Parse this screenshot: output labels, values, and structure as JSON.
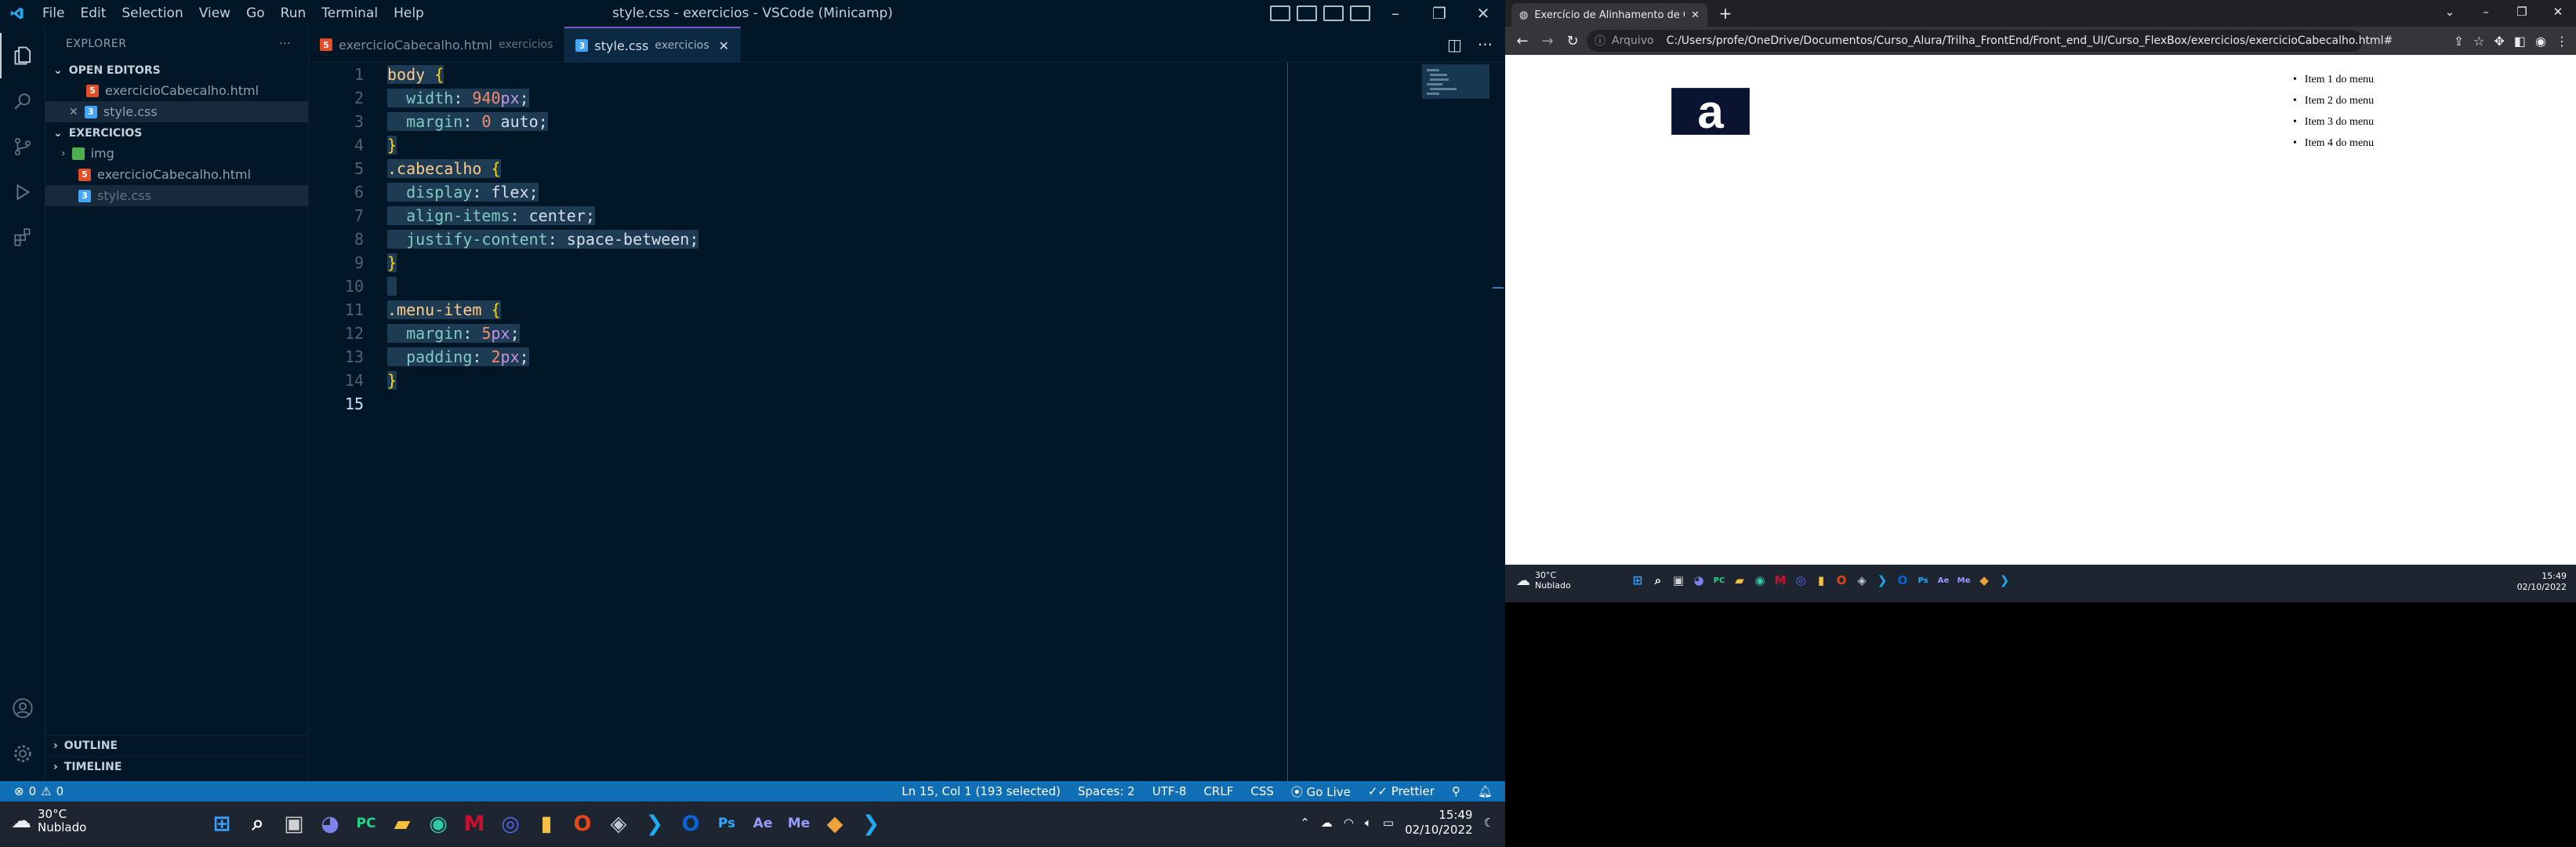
{
  "vscode": {
    "menu": [
      "File",
      "Edit",
      "Selection",
      "View",
      "Go",
      "Run",
      "Terminal",
      "Help"
    ],
    "window_title": "style.css - exercicios - VSCode (Minicamp)",
    "explorer": {
      "header": "EXPLORER",
      "open_editors_label": "OPEN EDITORS",
      "open_editors": [
        {
          "name": "exercicioCabecalho.html",
          "type": "html"
        },
        {
          "name": "style.css",
          "type": "css"
        }
      ],
      "folder_label": "EXERCICIOS",
      "folder_items": [
        {
          "name": "img",
          "type": "folder"
        },
        {
          "name": "exercicioCabecalho.html",
          "type": "html"
        },
        {
          "name": "style.css",
          "type": "css"
        }
      ],
      "outline_label": "OUTLINE",
      "timeline_label": "TIMELINE"
    },
    "tabs": [
      {
        "name": "exercicioCabecalho.html",
        "folder": "exercicios",
        "type": "html"
      },
      {
        "name": "style.css",
        "folder": "exercicios",
        "type": "css"
      }
    ],
    "line_numbers": [
      "1",
      "2",
      "3",
      "4",
      "5",
      "6",
      "7",
      "8",
      "9",
      "10",
      "11",
      "12",
      "13",
      "14",
      "15"
    ],
    "status": {
      "errors": "0",
      "warnings": "0",
      "position": "Ln 15, Col 1 (193 selected)",
      "spaces": "Spaces: 2",
      "encoding": "UTF-8",
      "eol": "CRLF",
      "language": "CSS",
      "golive": "Go Live",
      "prettier": "Prettier"
    },
    "taskbar": {
      "temp": "30°C",
      "condition": "Nublado",
      "time": "15:49",
      "date": "02/10/2022"
    }
  },
  "code_lines": [
    {
      "t": [
        {
          "c": "c-sel",
          "v": "body"
        },
        {
          "c": "c-txt",
          "v": " "
        },
        {
          "c": "c-br",
          "v": "{"
        }
      ]
    },
    {
      "t": [
        {
          "c": "c-txt",
          "v": "  "
        },
        {
          "c": "c-prop",
          "v": "width"
        },
        {
          "c": "c-txt",
          "v": ": "
        },
        {
          "c": "c-val",
          "v": "940"
        },
        {
          "c": "c-unit",
          "v": "px"
        },
        {
          "c": "c-txt",
          "v": ";"
        }
      ]
    },
    {
      "t": [
        {
          "c": "c-txt",
          "v": "  "
        },
        {
          "c": "c-prop",
          "v": "margin"
        },
        {
          "c": "c-txt",
          "v": ": "
        },
        {
          "c": "c-val",
          "v": "0"
        },
        {
          "c": "c-txt",
          "v": " auto;"
        }
      ]
    },
    {
      "t": [
        {
          "c": "c-br",
          "v": "}"
        }
      ]
    },
    {
      "t": [
        {
          "c": "c-sel",
          "v": ".cabecalho"
        },
        {
          "c": "c-txt",
          "v": " "
        },
        {
          "c": "c-br",
          "v": "{"
        }
      ]
    },
    {
      "t": [
        {
          "c": "c-txt",
          "v": "  "
        },
        {
          "c": "c-prop",
          "v": "display"
        },
        {
          "c": "c-txt",
          "v": ": flex;"
        }
      ]
    },
    {
      "t": [
        {
          "c": "c-txt",
          "v": "  "
        },
        {
          "c": "c-prop",
          "v": "align-items"
        },
        {
          "c": "c-txt",
          "v": ": center;"
        }
      ]
    },
    {
      "t": [
        {
          "c": "c-txt",
          "v": "  "
        },
        {
          "c": "c-prop",
          "v": "justify-content"
        },
        {
          "c": "c-txt",
          "v": ": space-between;"
        }
      ]
    },
    {
      "t": [
        {
          "c": "c-br",
          "v": "}"
        }
      ]
    },
    {
      "t": []
    },
    {
      "t": [
        {
          "c": "c-sel",
          "v": ".menu-item"
        },
        {
          "c": "c-txt",
          "v": " "
        },
        {
          "c": "c-br",
          "v": "{"
        }
      ]
    },
    {
      "t": [
        {
          "c": "c-txt",
          "v": "  "
        },
        {
          "c": "c-prop",
          "v": "margin"
        },
        {
          "c": "c-txt",
          "v": ": "
        },
        {
          "c": "c-val",
          "v": "5"
        },
        {
          "c": "c-unit",
          "v": "px"
        },
        {
          "c": "c-txt",
          "v": ";"
        }
      ]
    },
    {
      "t": [
        {
          "c": "c-txt",
          "v": "  "
        },
        {
          "c": "c-prop",
          "v": "padding"
        },
        {
          "c": "c-txt",
          "v": ": "
        },
        {
          "c": "c-val",
          "v": "2"
        },
        {
          "c": "c-unit",
          "v": "px"
        },
        {
          "c": "c-txt",
          "v": ";"
        }
      ]
    },
    {
      "t": [
        {
          "c": "c-br",
          "v": "}"
        }
      ]
    },
    {
      "t": []
    }
  ],
  "chrome": {
    "tab_title": "Exercício de Alinhamento de Cab",
    "address_prefix": "Arquivo",
    "url": "C:/Users/profe/OneDrive/Documentos/Curso_Alura/Trilha_FrontEnd/Front_end_UI/Curso_FlexBox/exercicios/exercicioCabecalho.html#",
    "logo_letter": "a",
    "menu_items": [
      "Item 1 do menu",
      "Item 2 do menu",
      "Item 3 do menu",
      "Item 4 do menu"
    ],
    "taskbar": {
      "temp": "30°C",
      "condition": "Nublado",
      "time": "15:49",
      "date": "02/10/2022"
    }
  },
  "taskbar_apps": [
    {
      "name": "start",
      "glyph": "⊞",
      "color": "#3aa0ff"
    },
    {
      "name": "search",
      "glyph": "⌕",
      "color": "#ffffff"
    },
    {
      "name": "task-view",
      "glyph": "▣",
      "color": "#d0d0d0"
    },
    {
      "name": "chat",
      "glyph": "◕",
      "color": "#7b83eb"
    },
    {
      "name": "pycharm",
      "glyph": "PC",
      "color": "#21d789"
    },
    {
      "name": "file-explorer",
      "glyph": "▰",
      "color": "#f3c13a"
    },
    {
      "name": "edge",
      "glyph": "◉",
      "color": "#2ec9a8"
    },
    {
      "name": "mcafee",
      "glyph": "M",
      "color": "#c8102e"
    },
    {
      "name": "discord",
      "glyph": "◎",
      "color": "#5865f2"
    },
    {
      "name": "notes",
      "glyph": "▮",
      "color": "#f5c044"
    },
    {
      "name": "office",
      "glyph": "O",
      "color": "#e3461c"
    },
    {
      "name": "incognito",
      "glyph": "◈",
      "color": "#bfc7d0"
    },
    {
      "name": "vscode",
      "glyph": "❯",
      "color": "#23a9f2"
    },
    {
      "name": "outlook",
      "glyph": "O",
      "color": "#0a64d6"
    },
    {
      "name": "photoshop",
      "glyph": "Ps",
      "color": "#31a8ff"
    },
    {
      "name": "after-effects",
      "glyph": "Ae",
      "color": "#9999ff"
    },
    {
      "name": "media-encoder",
      "glyph": "Me",
      "color": "#9999ff"
    },
    {
      "name": "git",
      "glyph": "◆",
      "color": "#f1a33a"
    },
    {
      "name": "vscode-2",
      "glyph": "❯",
      "color": "#23a9f2"
    }
  ]
}
